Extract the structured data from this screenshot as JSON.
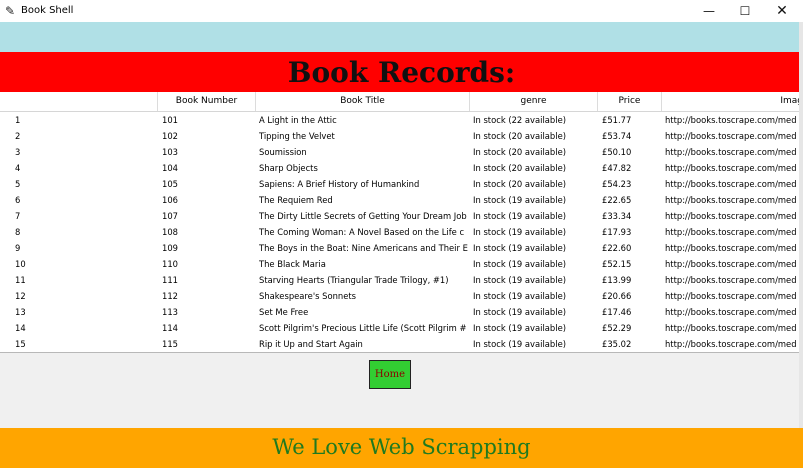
{
  "window": {
    "title": "Book Shell",
    "icon": "feather-icon",
    "minimize_glyph": "—",
    "maximize_glyph": "☐",
    "close_glyph": "✕"
  },
  "header": {
    "title": "Book Records:",
    "color": "#ff0000"
  },
  "table": {
    "columns": [
      "",
      "Book Number",
      "Book Title",
      "genre",
      "Price",
      "Imag"
    ],
    "rows": [
      [
        "1",
        "101",
        "A Light in the Attic",
        "In stock (22 available)",
        "£51.77",
        "http://books.toscrape.com/med"
      ],
      [
        "2",
        "102",
        "Tipping the Velvet",
        "In stock (20 available)",
        "£53.74",
        "http://books.toscrape.com/med"
      ],
      [
        "3",
        "103",
        "Soumission",
        "In stock (20 available)",
        "£50.10",
        "http://books.toscrape.com/med"
      ],
      [
        "4",
        "104",
        "Sharp Objects",
        "In stock (20 available)",
        "£47.82",
        "http://books.toscrape.com/med"
      ],
      [
        "5",
        "105",
        "Sapiens: A Brief History of Humankind",
        "In stock (20 available)",
        "£54.23",
        "http://books.toscrape.com/med"
      ],
      [
        "6",
        "106",
        "The Requiem Red",
        "In stock (19 available)",
        "£22.65",
        "http://books.toscrape.com/med"
      ],
      [
        "7",
        "107",
        "The Dirty Little Secrets of Getting Your Dream Job",
        "In stock (19 available)",
        "£33.34",
        "http://books.toscrape.com/med"
      ],
      [
        "8",
        "108",
        "The Coming Woman: A Novel Based on the Life c",
        "In stock (19 available)",
        "£17.93",
        "http://books.toscrape.com/med"
      ],
      [
        "9",
        "109",
        "The Boys in the Boat: Nine Americans and Their E",
        "In stock (19 available)",
        "£22.60",
        "http://books.toscrape.com/med"
      ],
      [
        "10",
        "110",
        "The Black Maria",
        "In stock (19 available)",
        "£52.15",
        "http://books.toscrape.com/med"
      ],
      [
        "11",
        "111",
        "Starving Hearts (Triangular Trade Trilogy, #1)",
        "In stock (19 available)",
        "£13.99",
        "http://books.toscrape.com/med"
      ],
      [
        "12",
        "112",
        "Shakespeare's Sonnets",
        "In stock (19 available)",
        "£20.66",
        "http://books.toscrape.com/med"
      ],
      [
        "13",
        "113",
        "Set Me Free",
        "In stock (19 available)",
        "£17.46",
        "http://books.toscrape.com/med"
      ],
      [
        "14",
        "114",
        "Scott Pilgrim's Precious Little Life (Scott Pilgrim #",
        "In stock (19 available)",
        "£52.29",
        "http://books.toscrape.com/med"
      ],
      [
        "15",
        "115",
        "Rip it Up and Start Again",
        "In stock (19 available)",
        "£35.02",
        "http://books.toscrape.com/med"
      ]
    ]
  },
  "home_button": {
    "label": "Home",
    "color": "#32cd32"
  },
  "footer": {
    "text": "We Love Web Scrapping",
    "color": "#ffa500"
  }
}
